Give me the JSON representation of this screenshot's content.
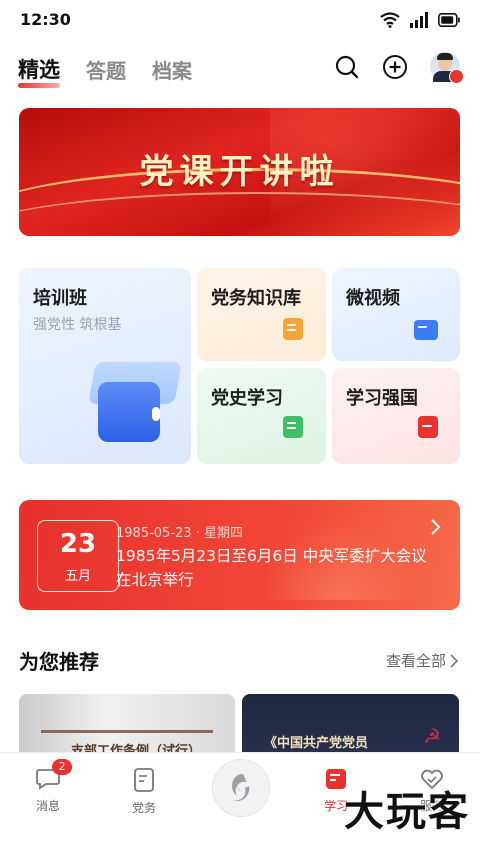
{
  "status": {
    "time": "12:30"
  },
  "tabs": [
    {
      "label": "精选",
      "active": true
    },
    {
      "label": "答题",
      "active": false
    },
    {
      "label": "档案",
      "active": false
    }
  ],
  "banner": {
    "title": "党课开讲啦"
  },
  "grid": {
    "training": {
      "title": "培训班",
      "subtitle": "强党性 筑根基"
    },
    "knowledge": {
      "title": "党务知识库"
    },
    "video": {
      "title": "微视频"
    },
    "history": {
      "title": "党史学习"
    },
    "xuexi": {
      "title": "学习强国"
    }
  },
  "today": {
    "day": "23",
    "month": "五月",
    "meta": "1985-05-23 · 星期四",
    "event": "1985年5月23日至6月6日 中央军委扩大会议在北京举行"
  },
  "recommend": {
    "title": "为您推荐",
    "view_all": "查看全部",
    "items": [
      {
        "text": "支部工作条例（试行）"
      },
      {
        "text": "《中国共产党党员"
      }
    ]
  },
  "nav": {
    "items": [
      {
        "label": "消息",
        "badge": "2",
        "active": false
      },
      {
        "label": "党务",
        "active": false
      },
      {
        "label": "学习",
        "active": true
      },
      {
        "label": "服务",
        "active": false
      }
    ]
  },
  "watermark": "大玩客",
  "colors": {
    "accent": "#e8322e"
  }
}
